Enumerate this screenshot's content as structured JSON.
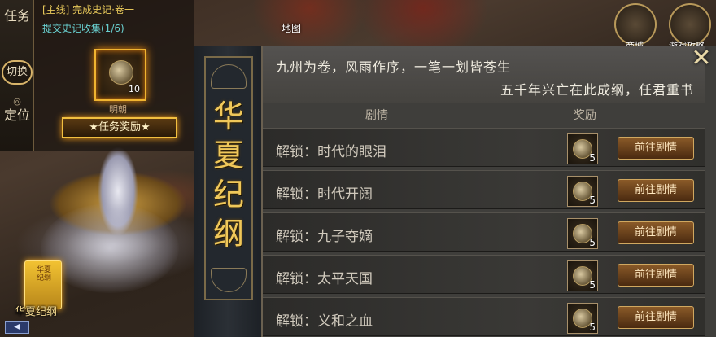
{
  "quest_tabs": {
    "task": "任务",
    "switch": "切换",
    "locate": "定位"
  },
  "quest": {
    "line1": "[主线] 完成史记·卷一",
    "line2": "提交史记收集(1/6)",
    "reward_count": "10",
    "reward_sub": "明朝",
    "reward_button": "★任务奖励★"
  },
  "top_nav": {
    "map": "地图",
    "btn1": "商城",
    "btn2": "游戏攻略"
  },
  "bottom_left": {
    "huaxia_icon_text": "华夏纪纲",
    "huaxia_label": "华夏纪纲",
    "arrow": "◀"
  },
  "dialog": {
    "side_title": "华夏纪纲",
    "poem_line1": "九州为卷，风雨作序，一笔一划皆苍生",
    "poem_line2": "五千年兴亡在此成纲，任君重书",
    "close": "✕",
    "col_story": "剧情",
    "col_reward": "奖励",
    "rows": [
      {
        "label": "解锁：时代的眼泪",
        "reward": "5",
        "button": "前往剧情"
      },
      {
        "label": "解锁：时代开阔",
        "reward": "5",
        "button": "前往剧情"
      },
      {
        "label": "解锁：九子夺嫡",
        "reward": "5",
        "button": "前往剧情"
      },
      {
        "label": "解锁：太平天国",
        "reward": "5",
        "button": "前往剧情"
      },
      {
        "label": "解锁：义和之血",
        "reward": "5",
        "button": "前往剧情"
      }
    ]
  },
  "colors": {
    "accent_gold": "#f0c85a",
    "button_bg": "#8a5a28",
    "quest_main": "#e7c85a",
    "quest_sub": "#6ad2d2"
  }
}
